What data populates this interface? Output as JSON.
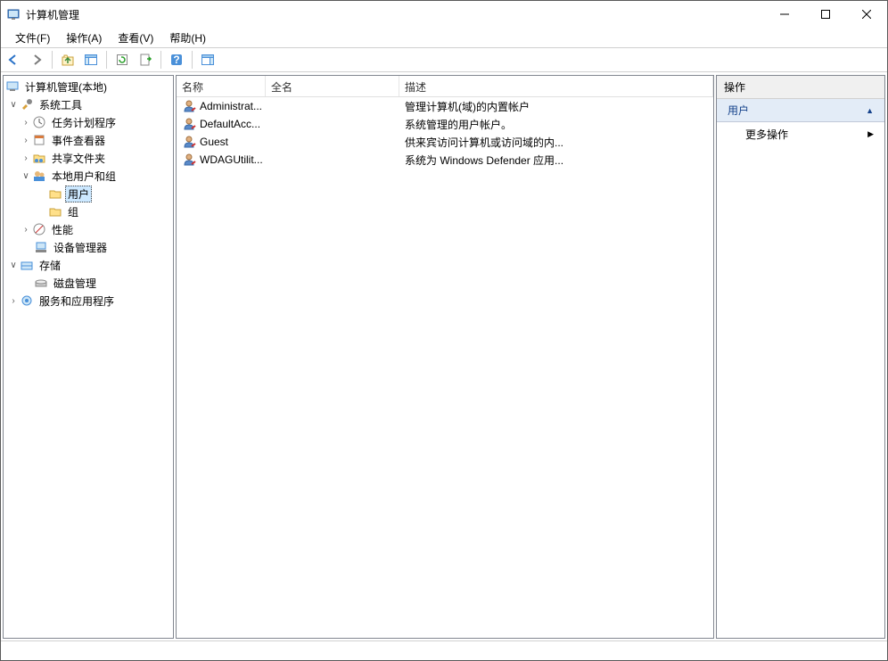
{
  "window": {
    "title": "计算机管理"
  },
  "menu": {
    "file": "文件(F)",
    "action": "操作(A)",
    "view": "查看(V)",
    "help": "帮助(H)"
  },
  "tree": {
    "root": "计算机管理(本地)",
    "systools": "系统工具",
    "scheduler": "任务计划程序",
    "eventviewer": "事件查看器",
    "sharedfolders": "共享文件夹",
    "localusers": "本地用户和组",
    "users": "用户",
    "groups": "组",
    "performance": "性能",
    "devicemgr": "设备管理器",
    "storage": "存储",
    "diskmgmt": "磁盘管理",
    "services": "服务和应用程序"
  },
  "list": {
    "col_name": "名称",
    "col_full": "全名",
    "col_desc": "描述",
    "rows": [
      {
        "name": "Administrat...",
        "full": "",
        "desc": "管理计算机(域)的内置帐户"
      },
      {
        "name": "DefaultAcc...",
        "full": "",
        "desc": "系统管理的用户帐户。"
      },
      {
        "name": "Guest",
        "full": "",
        "desc": "供来宾访问计算机或访问域的内..."
      },
      {
        "name": "WDAGUtilit...",
        "full": "",
        "desc": "系统为 Windows Defender 应用..."
      }
    ]
  },
  "actions": {
    "header": "操作",
    "context": "用户",
    "more": "更多操作"
  }
}
